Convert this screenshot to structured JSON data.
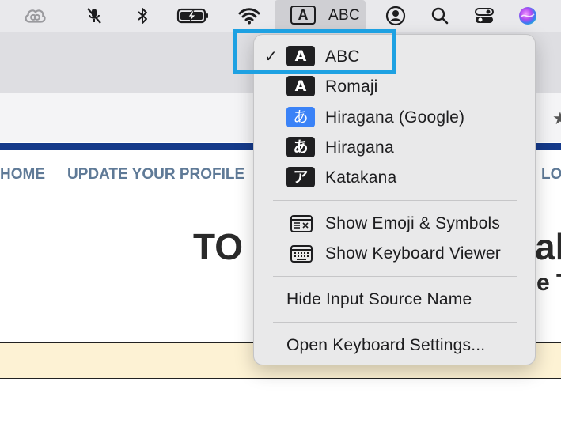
{
  "menubar": {
    "input_source": {
      "glyph": "A",
      "label": "ABC"
    },
    "icons": [
      "creative-cloud-icon",
      "microphone-muted-icon",
      "bluetooth-icon",
      "battery-charging-icon",
      "wifi-icon",
      "user-account-icon",
      "spotlight-search-icon",
      "control-center-icon",
      "siri-icon"
    ]
  },
  "page": {
    "nav": {
      "home": "HOME",
      "update_profile": "UPDATE YOUR PROFILE",
      "right_partial": "LO"
    },
    "title_partial_left": "TO",
    "title_partial_right": "ali",
    "subtitle_partial_right": "e T",
    "star_glyph": "★"
  },
  "menu": {
    "checkmark": "✓",
    "input_sources": [
      {
        "badge": "A",
        "badge_style": "dark",
        "label": "ABC",
        "checked": true
      },
      {
        "badge": "A",
        "badge_style": "dark",
        "label": "Romaji",
        "checked": false
      },
      {
        "badge": "あ",
        "badge_style": "blue",
        "label": "Hiragana (Google)",
        "checked": false
      },
      {
        "badge": "あ",
        "badge_style": "dark",
        "label": "Hiragana",
        "checked": false
      },
      {
        "badge": "ア",
        "badge_style": "dark",
        "label": "Katakana",
        "checked": false
      }
    ],
    "viewers": [
      {
        "icon": "emoji-symbols-icon",
        "label": "Show Emoji & Symbols"
      },
      {
        "icon": "keyboard-icon",
        "label": "Show Keyboard Viewer"
      }
    ],
    "hide_input_source_name": "Hide Input Source Name",
    "open_keyboard_settings": "Open Keyboard Settings..."
  },
  "colors": {
    "highlight": "#1ea1e2",
    "menu_bg": "#e9e9ea",
    "badge_dark": "#1f1f21",
    "badge_blue": "#3a82f7",
    "nav_blue": "#153a8a"
  }
}
